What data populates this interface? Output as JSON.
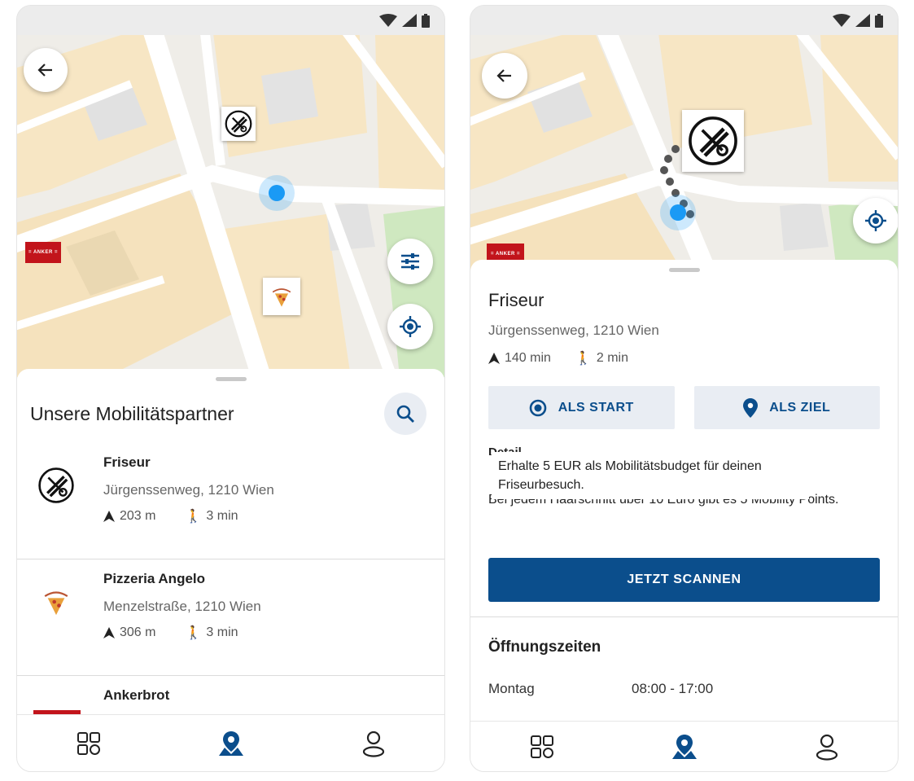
{
  "screen1": {
    "sheet_title": "Unsere Mobilitätspartner",
    "partners": [
      {
        "name": "Friseur",
        "address": "Jürgenssenweg, 1210 Wien",
        "distance": "203 m",
        "walk": "3 min",
        "logo": "scissors-comb-icon"
      },
      {
        "name": "Pizzeria Angelo",
        "address": "Menzelstraße, 1210 Wien",
        "distance": "306 m",
        "walk": "3 min",
        "logo": "pizza-logo"
      },
      {
        "name": "Ankerbrot",
        "address": "",
        "distance": "",
        "walk": "",
        "logo": "anker-logo"
      }
    ]
  },
  "screen2": {
    "title": "Friseur",
    "address": "Jürgenssenweg, 1210 Wien",
    "drive_time": "140 min",
    "walk_time": "2 min",
    "btn_start": "ALS START",
    "btn_ziel": "ALS ZIEL",
    "tooltip": "Erhalte 5 EUR als Mobilitätsbudget für deinen Friseurbesuch.",
    "description": "Bei jedem Haarschnitt über 10 Euro gibt es 5 Mobility Points.",
    "scan_button": "JETZT SCANNEN",
    "hours_title": "Öffnungszeiten",
    "hours": [
      {
        "day": "Montag",
        "time": "08:00 - 17:00"
      }
    ]
  },
  "icons": {
    "back": "arrow-left-icon",
    "filter": "sliders-icon",
    "locate": "my-location-icon",
    "search": "search-icon",
    "nav": [
      "grid-icon",
      "map-pin-person-icon",
      "user-icon"
    ]
  },
  "colors": {
    "primary": "#0b4e8c",
    "user_dot": "#1a9af5",
    "anker": "#c2141b"
  }
}
